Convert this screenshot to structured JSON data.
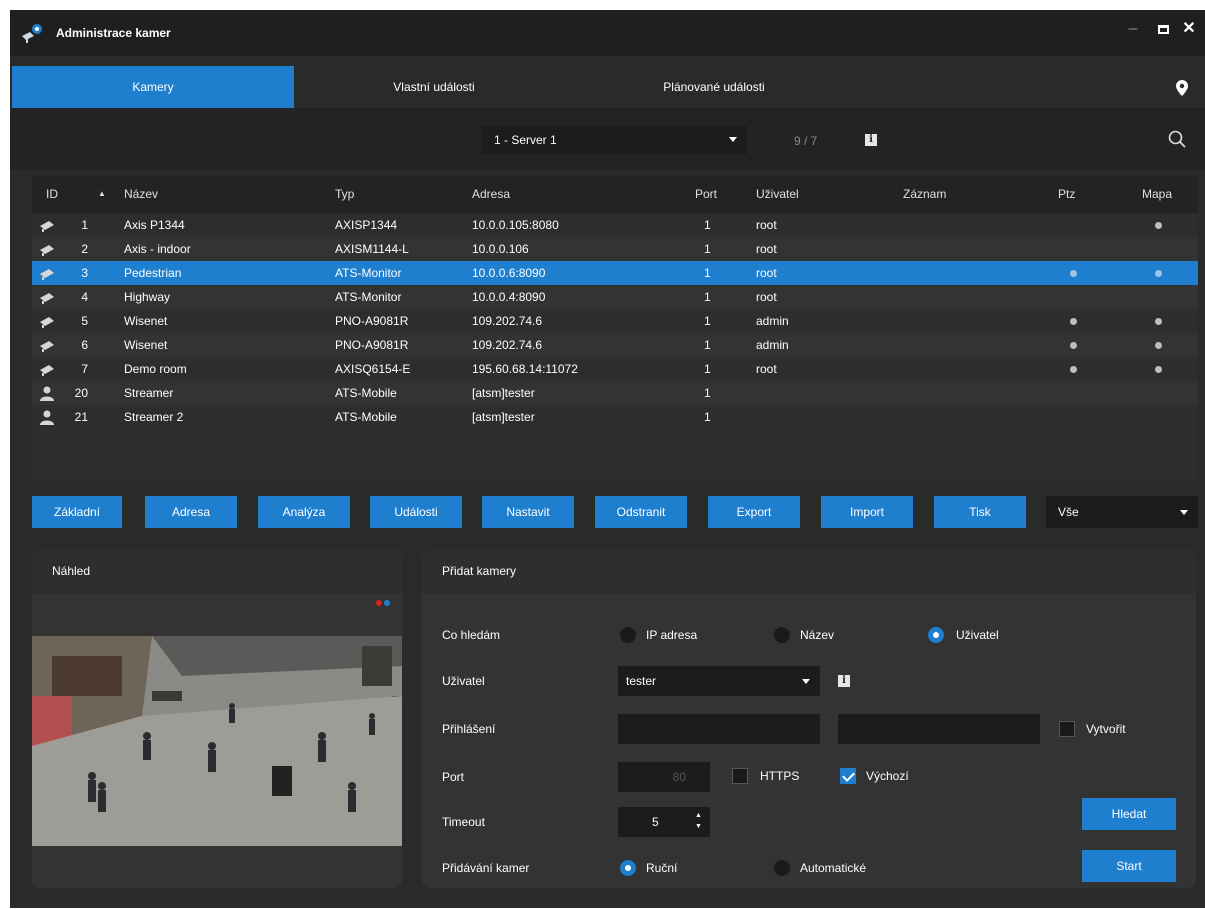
{
  "window": {
    "title": "Administrace kamer"
  },
  "tabs": [
    {
      "label": "Kamery",
      "active": true
    },
    {
      "label": "Vlastní události",
      "active": false
    },
    {
      "label": "Plánované události",
      "active": false
    }
  ],
  "toolbar": {
    "server_select": "1 - Server 1",
    "count": "9 / 7"
  },
  "table": {
    "headers": {
      "id": "ID",
      "name": "Název",
      "type": "Typ",
      "address": "Adresa",
      "port": "Port",
      "user": "Uživatel",
      "record": "Záznam",
      "ptz": "Ptz",
      "map": "Mapa"
    },
    "rows": [
      {
        "icon": "camera-icon",
        "id": "1",
        "name": "Axis P1344",
        "type": "AXISP1344",
        "address": "10.0.0.105:8080",
        "port": "1",
        "user": "root",
        "ptz": false,
        "map": true,
        "selected": false
      },
      {
        "icon": "camera-icon",
        "id": "2",
        "name": "Axis - indoor",
        "type": "AXISM1144-L",
        "address": "10.0.0.106",
        "port": "1",
        "user": "root",
        "ptz": false,
        "map": false,
        "selected": false
      },
      {
        "icon": "camera-icon",
        "id": "3",
        "name": "Pedestrian",
        "type": "ATS-Monitor",
        "address": "10.0.0.6:8090",
        "port": "1",
        "user": "root",
        "ptz": true,
        "map": true,
        "selected": true
      },
      {
        "icon": "camera-icon",
        "id": "4",
        "name": "Highway",
        "type": "ATS-Monitor",
        "address": "10.0.0.4:8090",
        "port": "1",
        "user": "root",
        "ptz": false,
        "map": false,
        "selected": false
      },
      {
        "icon": "camera-icon",
        "id": "5",
        "name": "Wisenet",
        "type": "PNO-A9081R",
        "address": "109.202.74.6",
        "port": "1",
        "user": "admin",
        "ptz": true,
        "map": true,
        "selected": false
      },
      {
        "icon": "camera-icon",
        "id": "6",
        "name": "Wisenet",
        "type": "PNO-A9081R",
        "address": "109.202.74.6",
        "port": "1",
        "user": "admin",
        "ptz": true,
        "map": true,
        "selected": false
      },
      {
        "icon": "camera-icon",
        "id": "7",
        "name": "Demo room",
        "type": "AXISQ6154-E",
        "address": "195.60.68.14:11072",
        "port": "1",
        "user": "root",
        "ptz": true,
        "map": true,
        "selected": false
      },
      {
        "icon": "person-icon",
        "id": "20",
        "name": "Streamer",
        "type": "ATS-Mobile",
        "address": "[atsm]tester",
        "port": "1",
        "user": "",
        "ptz": false,
        "map": false,
        "selected": false
      },
      {
        "icon": "person-icon",
        "id": "21",
        "name": "Streamer 2",
        "type": "ATS-Mobile",
        "address": "[atsm]tester",
        "port": "1",
        "user": "",
        "ptz": false,
        "map": false,
        "selected": false
      }
    ]
  },
  "actions": [
    "Základní",
    "Adresa",
    "Analýza",
    "Události",
    "Nastavit",
    "Odstranit",
    "Export",
    "Import",
    "Tisk"
  ],
  "filter_select": "Vše",
  "preview": {
    "title": "Náhled"
  },
  "add_cameras": {
    "title": "Přidat kamery",
    "search_label": "Co hledám",
    "search_options": [
      {
        "label": "IP adresa",
        "checked": false
      },
      {
        "label": "Název",
        "checked": false
      },
      {
        "label": "Uživatel",
        "checked": true
      }
    ],
    "user_label": "Uživatel",
    "user_value": "tester",
    "login_label": "Přihlášení",
    "create_label": "Vytvořit",
    "create_checked": false,
    "port_label": "Port",
    "port_value": "80",
    "https_label": "HTTPS",
    "https_checked": false,
    "default_label": "Výchozí",
    "default_checked": true,
    "timeout_label": "Timeout",
    "timeout_value": "5",
    "adding_label": "Přidávání kamer",
    "adding_options": [
      {
        "label": "Ruční",
        "checked": true
      },
      {
        "label": "Automatické",
        "checked": false
      }
    ],
    "search_button": "Hledat",
    "start_button": "Start"
  },
  "colors": {
    "accent": "#1f7fcf",
    "background": "#2a2a2a"
  }
}
